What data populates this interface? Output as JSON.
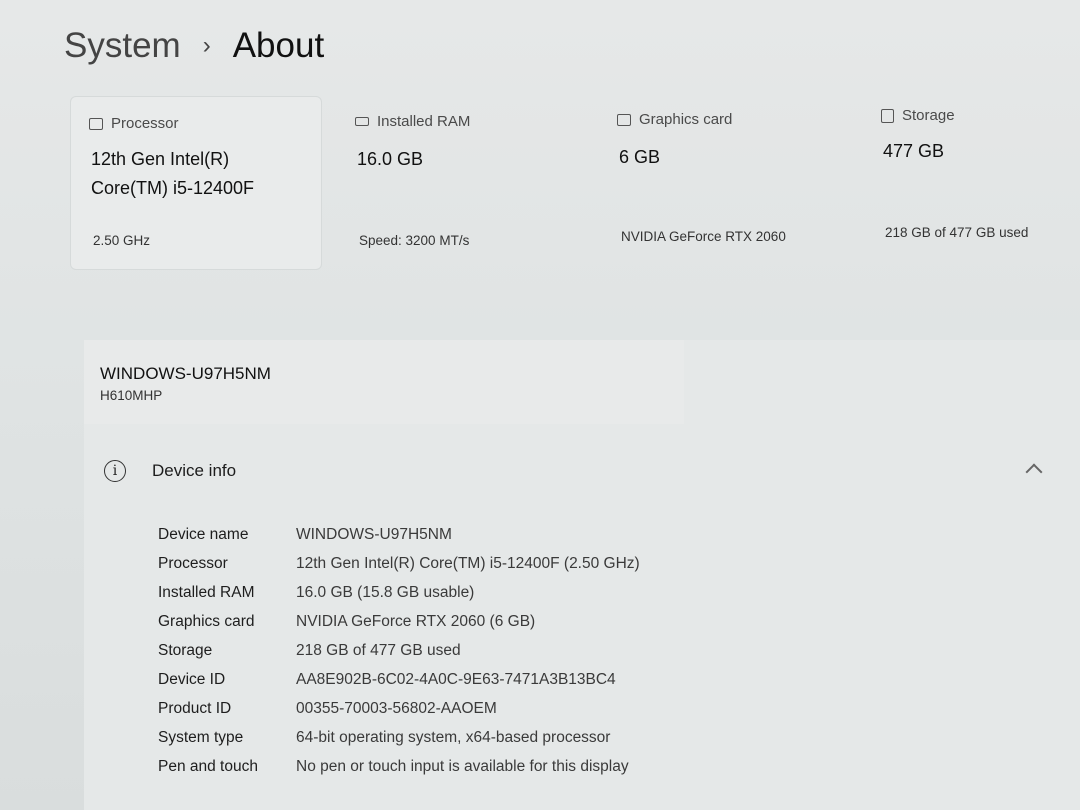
{
  "breadcrumb": {
    "parent": "System",
    "separator": "›",
    "current": "About"
  },
  "spec_cards": [
    {
      "icon": "processor-icon",
      "label": "Processor",
      "value": "12th Gen Intel(R) Core(TM) i5-12400F",
      "sub": "2.50 GHz"
    },
    {
      "icon": "ram-icon",
      "label": "Installed RAM",
      "value": "16.0 GB",
      "sub": "Speed: 3200 MT/s"
    },
    {
      "icon": "graphics-card-icon",
      "label": "Graphics card",
      "value": "6 GB",
      "sub": "NVIDIA GeForce RTX 2060"
    },
    {
      "icon": "storage-icon",
      "label": "Storage",
      "value": "477 GB",
      "sub": "218 GB of 477 GB used"
    }
  ],
  "device": {
    "name": "WINDOWS-U97H5NM",
    "model": "H610MHP"
  },
  "device_info": {
    "title": "Device info",
    "icon": "info-icon",
    "rows": [
      {
        "key": "Device name",
        "value": "WINDOWS-U97H5NM"
      },
      {
        "key": "Processor",
        "value": "12th Gen Intel(R) Core(TM) i5-12400F (2.50 GHz)"
      },
      {
        "key": "Installed RAM",
        "value": "16.0 GB (15.8 GB usable)"
      },
      {
        "key": "Graphics card",
        "value": "NVIDIA GeForce RTX 2060 (6 GB)"
      },
      {
        "key": "Storage",
        "value": "218 GB of 477 GB used"
      },
      {
        "key": "Device ID",
        "value": "AA8E902B-6C02-4A0C-9E63-7471A3B13BC4"
      },
      {
        "key": "Product ID",
        "value": "00355-70003-56802-AAOEM"
      },
      {
        "key": "System type",
        "value": "64-bit operating system, x64-based processor"
      },
      {
        "key": "Pen and touch",
        "value": "No pen or touch input is available for this display"
      }
    ]
  }
}
